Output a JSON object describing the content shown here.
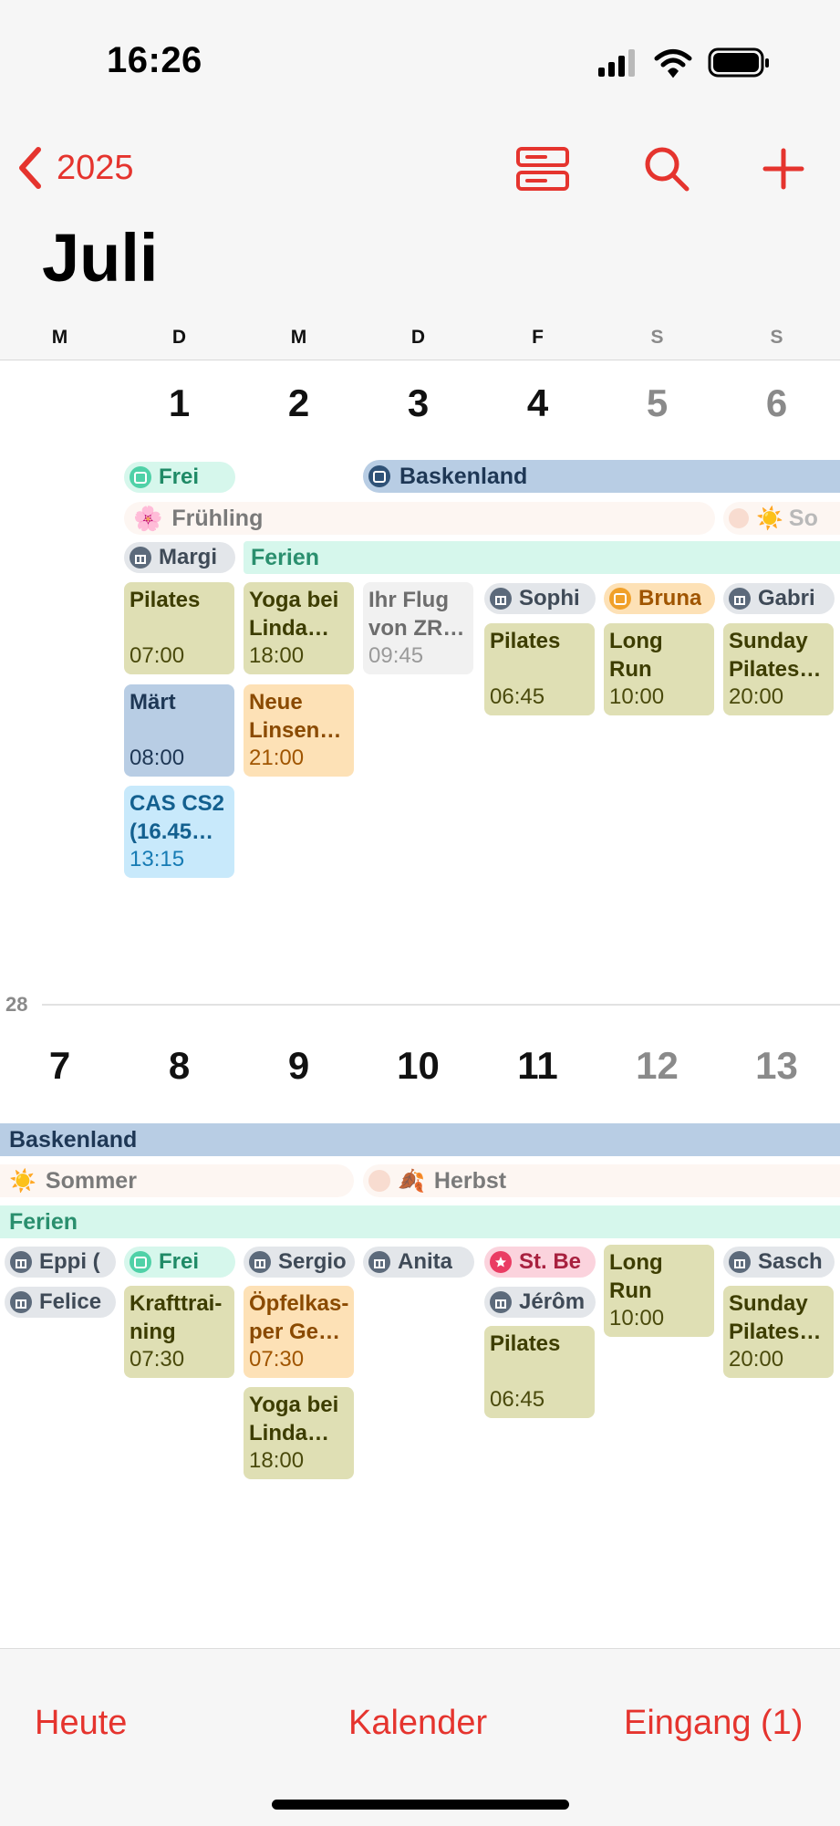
{
  "status_bar": {
    "time": "16:26"
  },
  "nav": {
    "back_label": "2025",
    "month_title": "Juli"
  },
  "weekdays": [
    "M",
    "D",
    "M",
    "D",
    "F",
    "S",
    "S"
  ],
  "week1": {
    "days": [
      "1",
      "2",
      "3",
      "4",
      "5",
      "6"
    ],
    "chips": {
      "frei": "Frei",
      "marg": "Margi",
      "sophi": "Sophi",
      "bruna": "Bruna",
      "gabri": "Gabri"
    },
    "spans": {
      "baskenland": "Baskenland",
      "fruehling": "Frühling",
      "sommer": "So",
      "ferien": "Ferien"
    },
    "events": {
      "pilates_tue": {
        "title": "Pilates",
        "time": "07:00"
      },
      "maert": {
        "title": "Märt",
        "time": "08:00"
      },
      "cas": {
        "title": "CAS CS2 (16.45…",
        "time": "13:15"
      },
      "yoga_wed": {
        "title": "Yoga bei Linda…",
        "time": "18:00"
      },
      "linsen": {
        "title": "Neue Linsen…",
        "time": "21:00"
      },
      "flug": {
        "title": "Ihr Flug von ZR…",
        "time": "09:45"
      },
      "pilates_fri": {
        "title": "Pilates",
        "time": "06:45"
      },
      "longrun_sat": {
        "title": "Long Run",
        "time": "10:00"
      },
      "sunday_pilates": {
        "title": "Sunday Pilates…",
        "time": "20:00"
      }
    }
  },
  "week2": {
    "week_number": "28",
    "days": [
      "7",
      "8",
      "9",
      "10",
      "11",
      "12",
      "13"
    ],
    "spans": {
      "baskenland": "Baskenland",
      "sommer": "Sommer",
      "herbst": "Herbst",
      "ferien": "Ferien"
    },
    "chips": {
      "eppi": "Eppi (",
      "felice": "Felice",
      "frei": "Frei",
      "sergio": "Sergio",
      "anita": "Anita",
      "stbe": "St. Be",
      "jerom": "Jérôm",
      "sasch": "Sasch"
    },
    "events": {
      "kraft": {
        "title": "Krafttrai-ning",
        "time": "07:30"
      },
      "oepfel": {
        "title": "Öpfelkas-per Ge…",
        "time": "07:30"
      },
      "yoga_wed": {
        "title": "Yoga bei Linda…",
        "time": "18:00"
      },
      "pilates_fri": {
        "title": "Pilates",
        "time": "06:45"
      },
      "longrun_sat": {
        "title": "Long Run",
        "time": "10:00"
      },
      "sunday_pilates": {
        "title": "Sunday Pilates…",
        "time": "20:00"
      }
    }
  },
  "tab_bar": {
    "today": "Heute",
    "calendars": "Kalender",
    "inbox": "Eingang (1)"
  },
  "colors": {
    "accent": "#e5342e",
    "olive_event": "#dfdfb4",
    "slate_event": "#b8cde4",
    "orange_event": "#fde1b6",
    "sky_event": "#c8e9fb",
    "mint_chip": "#d6f7ec",
    "pink_chip": "#fbd3dd"
  }
}
